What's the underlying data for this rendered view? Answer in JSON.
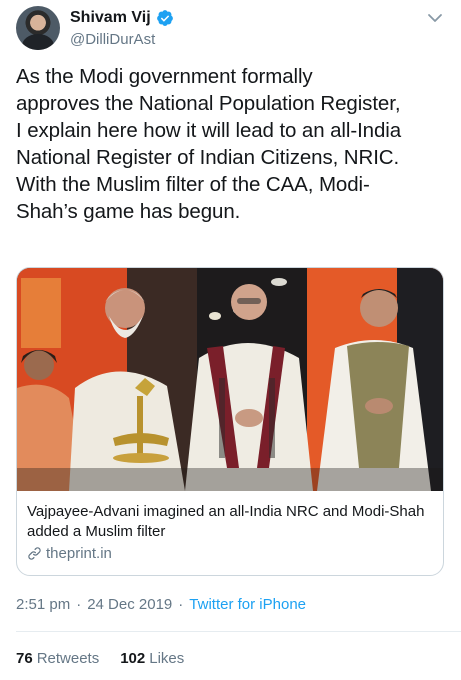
{
  "author": {
    "display_name": "Shivam Vij",
    "handle": "@DilliDurAst"
  },
  "tweet": {
    "text": "As the Modi government formally\napproves the National Population Register,\nI explain here how it will lead to an all-India\nNational Register of Indian Citizens, NRIC.\nWith the Muslim filter of the CAA, Modi-\nShah’s game has begun."
  },
  "card": {
    "title": "Vajpayee-Advani imagined an all-India NRC and Modi-Shah added a Muslim filter",
    "domain": "theprint.in"
  },
  "meta": {
    "time": "2:51 pm",
    "separator": "·",
    "date": "24 Dec 2019",
    "source": "Twitter for iPhone"
  },
  "stats": {
    "retweets_count": "76",
    "retweets_label": "Retweets",
    "likes_count": "102",
    "likes_label": "Likes"
  },
  "colors": {
    "accent": "#1da1f2",
    "muted": "#657786",
    "text": "#14171a"
  },
  "icons": [
    "verified-icon",
    "chevron-down-icon",
    "link-icon"
  ]
}
